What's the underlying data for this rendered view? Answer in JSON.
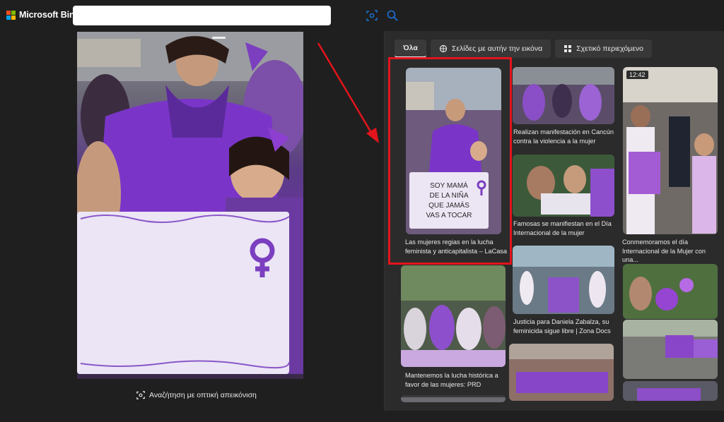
{
  "brand": {
    "name": "Microsoft Bing"
  },
  "search": {
    "value": "",
    "visual_search_icon": "camera-scan-icon",
    "search_icon": "search-icon"
  },
  "left_panel": {
    "visual_search_label": "Αναζήτηση με οπτική απεικόνιση"
  },
  "tabs": [
    {
      "label": "Όλα",
      "icon": ""
    },
    {
      "label": "Σελίδες με αυτήν την εικόνα",
      "icon": "globe-grid-icon"
    },
    {
      "label": "Σχετικό περιεχόμενο",
      "icon": "tiles-icon"
    }
  ],
  "results": [
    {
      "caption": "Las mujeres regias en la lucha feminista y anticapitalista – LaCasa"
    },
    {
      "caption": "Realizan manifestación en Cancún contra la violencia a la mujer"
    },
    {
      "caption": "Conmemoramos el día Internacional de la Mujer con una..."
    },
    {
      "caption": "Famosas se manifiestan en el Día Internacional de la mujer"
    },
    {
      "caption": "Justicia para Daniela Zabalza, su feminicida sigue libre | Zona Docs"
    },
    {
      "caption": "Mantenemos la lucha histórica a favor de las mujeres: PRD"
    }
  ],
  "video_badge": "12:42",
  "sign_text": "SOY MAMÁ DE LA NIÑA QUE JAMÁS VAS A TOCAR",
  "colors": {
    "accent_purple": "#7b3fbf",
    "highlight_red": "#e3141c",
    "background": "#1f1f1f",
    "panel": "#2b2b2b"
  }
}
